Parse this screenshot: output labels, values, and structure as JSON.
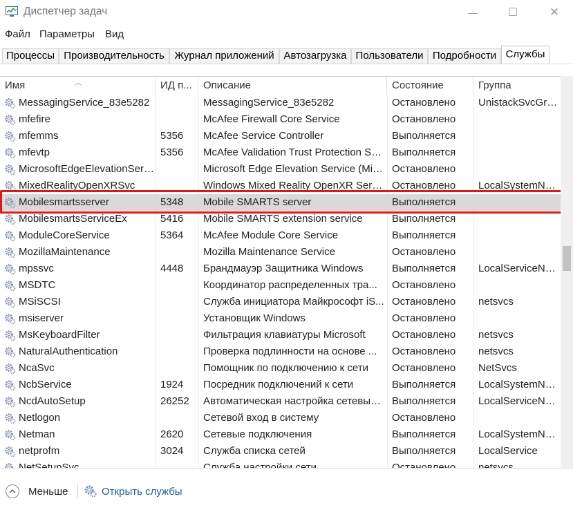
{
  "window": {
    "title": "Диспетчер задач",
    "minimize": "—",
    "maximize": "☐",
    "close": "✕"
  },
  "menu": [
    "Файл",
    "Параметры",
    "Вид"
  ],
  "tabs": [
    "Процессы",
    "Производительность",
    "Журнал приложений",
    "Автозагрузка",
    "Пользователи",
    "Подробности",
    "Службы"
  ],
  "active_tab": "Службы",
  "columns": [
    "Имя",
    "ИД п...",
    "Описание",
    "Состояние",
    "Группа"
  ],
  "rows": [
    {
      "name": "MessagingService_83e5282",
      "pid": "",
      "desc": "MessagingService_83e5282",
      "state": "Остановлено",
      "group": "UnistackSvcGro..."
    },
    {
      "name": "mfefire",
      "pid": "",
      "desc": "McAfee Firewall Core Service",
      "state": "Остановлено",
      "group": ""
    },
    {
      "name": "mfemms",
      "pid": "5356",
      "desc": "McAfee Service Controller",
      "state": "Выполняется",
      "group": ""
    },
    {
      "name": "mfevtp",
      "pid": "5356",
      "desc": "McAfee Validation Trust Protection Se...",
      "state": "Выполняется",
      "group": ""
    },
    {
      "name": "MicrosoftEdgeElevationServ...",
      "pid": "",
      "desc": "Microsoft Edge Elevation Service (Mic...",
      "state": "Остановлено",
      "group": ""
    },
    {
      "name": "MixedRealityOpenXRSvc",
      "pid": "",
      "desc": "Windows Mixed Reality OpenXR Servi...",
      "state": "Остановлено",
      "group": "LocalSystemNe..."
    },
    {
      "name": "Mobilesmartsserver",
      "pid": "5348",
      "desc": "Mobile SMARTS server",
      "state": "Выполняется",
      "group": ""
    },
    {
      "name": "MobilesmartsServiceEx",
      "pid": "5416",
      "desc": "Mobile SMARTS extension service",
      "state": "Выполняется",
      "group": ""
    },
    {
      "name": "ModuleCoreService",
      "pid": "5364",
      "desc": "McAfee Module Core Service",
      "state": "Выполняется",
      "group": ""
    },
    {
      "name": "MozillaMaintenance",
      "pid": "",
      "desc": "Mozilla Maintenance Service",
      "state": "Остановлено",
      "group": ""
    },
    {
      "name": "mpssvc",
      "pid": "4448",
      "desc": "Брандмауэр Защитника Windows",
      "state": "Выполняется",
      "group": "LocalServiceNo..."
    },
    {
      "name": "MSDTC",
      "pid": "",
      "desc": "Координатор распределенных тра...",
      "state": "Остановлено",
      "group": ""
    },
    {
      "name": "MSiSCSI",
      "pid": "",
      "desc": "Служба инициатора Майкрософт iS...",
      "state": "Остановлено",
      "group": "netsvcs"
    },
    {
      "name": "msiserver",
      "pid": "",
      "desc": "Установщик Windows",
      "state": "Остановлено",
      "group": ""
    },
    {
      "name": "MsKeyboardFilter",
      "pid": "",
      "desc": "Фильтрация клавиатуры Microsoft",
      "state": "Остановлено",
      "group": "netsvcs"
    },
    {
      "name": "NaturalAuthentication",
      "pid": "",
      "desc": "Проверка подлинности на основе ...",
      "state": "Остановлено",
      "group": "netsvcs"
    },
    {
      "name": "NcaSvc",
      "pid": "",
      "desc": "Помощник по подключению к сети",
      "state": "Остановлено",
      "group": "NetSvcs"
    },
    {
      "name": "NcbService",
      "pid": "1924",
      "desc": "Посредник подключений к сети",
      "state": "Выполняется",
      "group": "LocalSystemNe..."
    },
    {
      "name": "NcdAutoSetup",
      "pid": "26252",
      "desc": "Автоматическая настройка сетевых...",
      "state": "Выполняется",
      "group": "LocalServiceNo..."
    },
    {
      "name": "Netlogon",
      "pid": "",
      "desc": "Сетевой вход в систему",
      "state": "Остановлено",
      "group": ""
    },
    {
      "name": "Netman",
      "pid": "2620",
      "desc": "Сетевые подключения",
      "state": "Выполняется",
      "group": "LocalSystemNe..."
    },
    {
      "name": "netprofm",
      "pid": "3024",
      "desc": "Служба списка сетей",
      "state": "Выполняется",
      "group": "LocalService"
    },
    {
      "name": "NetSetupSvc",
      "pid": "",
      "desc": "Служба настройки сети",
      "state": "Остановлено",
      "group": "netsvcs"
    }
  ],
  "selected_service": "Mobilesmartsserver",
  "footer": {
    "less": "Меньше",
    "open_services": "Открыть службы"
  },
  "colors": {
    "highlight": "#e8140e",
    "link": "#1460a8",
    "selected_row": "#d9d9d9"
  }
}
